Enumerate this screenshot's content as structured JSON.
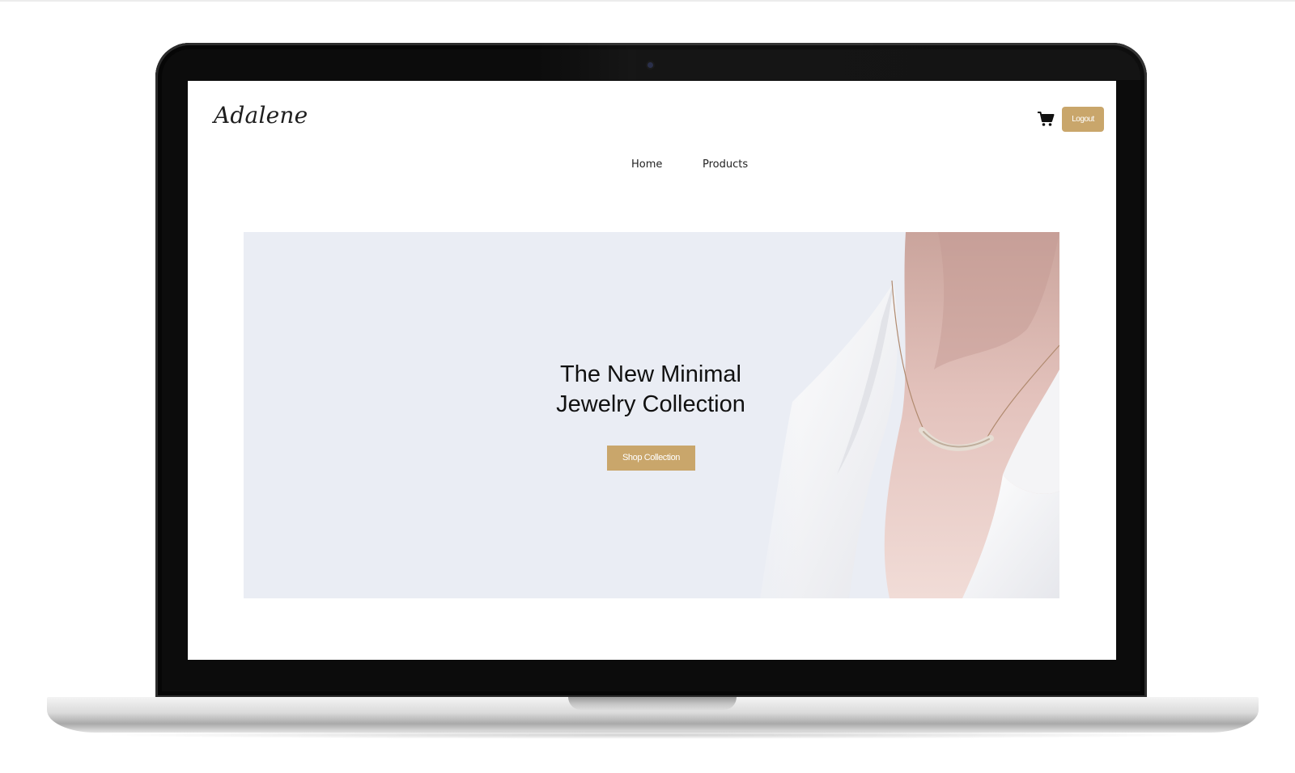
{
  "site": {
    "logo": "Adalene",
    "nav": [
      {
        "label": "Home"
      },
      {
        "label": "Products"
      }
    ],
    "header": {
      "logout_label": "Logout",
      "cart_icon": "shopping-cart-icon"
    }
  },
  "hero": {
    "title_line1": "The New Minimal",
    "title_line2": "Jewelry Collection",
    "cta_label": "Shop Collection",
    "image_subject": "necklace-model-photo"
  },
  "colors": {
    "accent": "#c9a66b",
    "hero_background": "#eaedf4",
    "text": "#111111"
  }
}
